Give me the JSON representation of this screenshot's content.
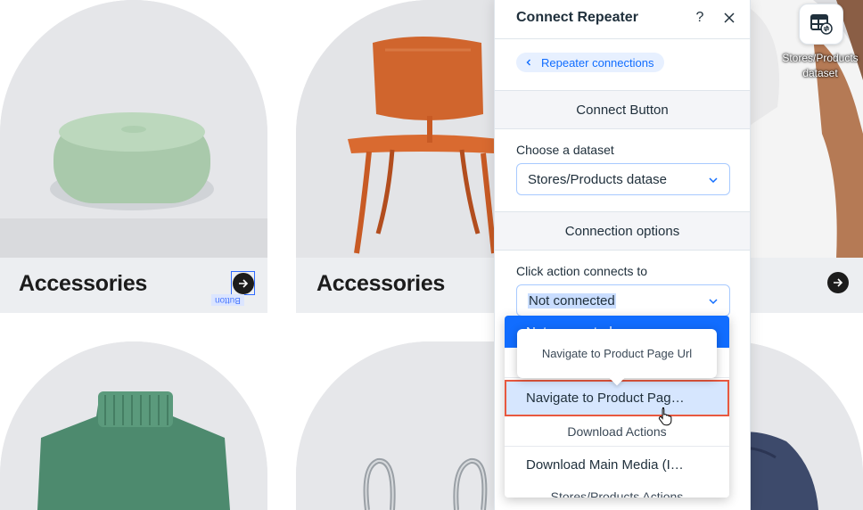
{
  "canvas": {
    "cards": [
      {
        "title": "Accessories",
        "image": "green pouf"
      },
      {
        "title": "Accessories",
        "image": "orange wooden chair"
      },
      {
        "title": "",
        "image": "man in white t-shirt"
      },
      {
        "title": "",
        "image": "green knit sweater"
      },
      {
        "title": "",
        "image": "silver earrings"
      },
      {
        "title": "",
        "image": "blue cap"
      }
    ],
    "selected_element_tag": "Button"
  },
  "panel": {
    "title": "Connect Repeater",
    "help_icon": "?",
    "back_link": "Repeater connections",
    "section_connect": "Connect Button",
    "dataset_label": "Choose a dataset",
    "dataset_value": "Stores/Products datase",
    "section_options": "Connection options",
    "click_action_label": "Click action connects to",
    "click_action_value": "Not connected"
  },
  "dropdown": {
    "selected_partial": "Not connected",
    "tooltip": "Navigate to Product Page Url",
    "hover_item": "Navigate to Product Pag…",
    "cat_download": "Download Actions",
    "download_item": "Download Main Media (I…",
    "cat_stores": "Stores/Products Actions"
  },
  "dataset_tile": {
    "label": "Stores/Products dataset"
  },
  "colors": {
    "accent": "#116dff",
    "hover_outline": "#e8583f",
    "hover_fill": "#d6e6fe",
    "card_bg": "#e8e9ec"
  }
}
